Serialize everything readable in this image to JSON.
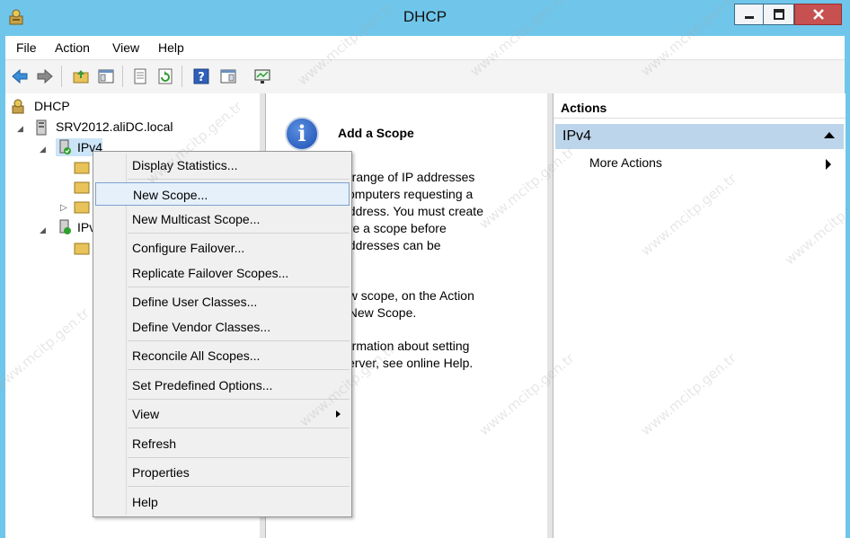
{
  "window": {
    "title": "DHCP",
    "controls": {
      "minimize": "minimize-icon",
      "maximize": "maximize-icon",
      "close": "close-icon"
    }
  },
  "menu": [
    "File",
    "Action",
    "View",
    "Help"
  ],
  "toolbar": {
    "icons": [
      "back-icon",
      "forward-icon",
      "up-folder-icon",
      "show-hide-tree-icon",
      "export-list-icon",
      "refresh-icon",
      "help-icon",
      "show-hide-action-pane-icon",
      "display-statistics-icon"
    ]
  },
  "tree": {
    "root": "DHCP",
    "server": "SRV2012.aliDC.local",
    "ipv4": "IPv4",
    "ipv6_partial": "IPv"
  },
  "details": {
    "heading": "Add a Scope",
    "lines": [
      "a range of IP addresses",
      "computers requesting a",
      "address. You must create",
      "ure a scope before",
      "addresses can be",
      "ew scope, on the Action",
      "t New Scope.",
      "formation about setting",
      "server, see online Help."
    ]
  },
  "actions": {
    "header": "Actions",
    "section": "IPv4",
    "more": "More Actions"
  },
  "context_menu": {
    "items": [
      "Display Statistics...",
      "New Scope...",
      "New Multicast Scope...",
      "Configure Failover...",
      "Replicate Failover Scopes...",
      "Define User Classes...",
      "Define Vendor Classes...",
      "Reconcile All Scopes...",
      "Set Predefined Options...",
      "View",
      "Refresh",
      "Properties",
      "Help"
    ],
    "highlighted": "New Scope..."
  },
  "watermark": "www.mcitp.gen.tr",
  "colors": {
    "titlebar": "#6fc6ea",
    "close": "#c75050",
    "highlight": "#e5f0fb",
    "actions_section": "#bcd5ea"
  }
}
